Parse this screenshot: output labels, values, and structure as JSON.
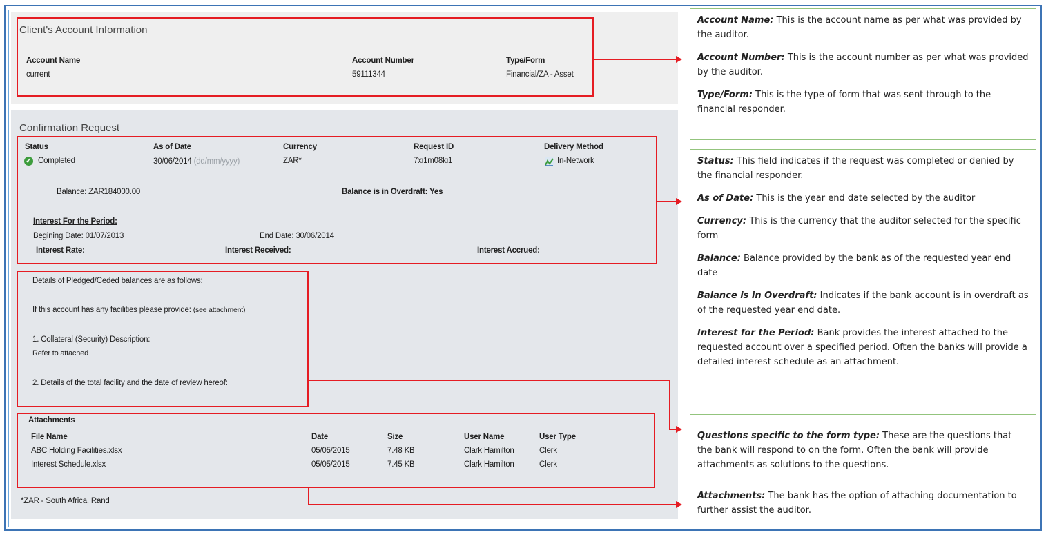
{
  "client_account": {
    "title": "Client's Account Information",
    "account_name_label": "Account Name",
    "account_name": "current",
    "account_number_label": "Account Number",
    "account_number": "59111344",
    "type_form_label": "Type/Form",
    "type_form": "Financial/ZA - Asset"
  },
  "confirmation": {
    "title": "Confirmation Request",
    "status_label": "Status",
    "status": "Completed",
    "as_of_date_label": "As of Date",
    "as_of_date": "30/06/2014",
    "date_format_hint": "(dd/mm/yyyy)",
    "currency_label": "Currency",
    "currency": "ZAR*",
    "request_id_label": "Request ID",
    "request_id": "7xi1m08ki1",
    "delivery_method_label": "Delivery Method",
    "delivery_method": "In-Network",
    "balance": "Balance: ZAR184000.00",
    "overdraft": "Balance is in Overdraft: Yes",
    "interest_title": "Interest For the Period:",
    "begin_date": "Begining Date: 01/07/2013",
    "end_date": "End Date: 30/06/2014",
    "interest_rate_label": "Interest Rate:",
    "interest_received_label": "Interest Received:",
    "interest_accrued_label": "Interest Accrued:"
  },
  "questions": {
    "q_pledged": "Details of Pledged/Ceded balances are as follows:",
    "q_facilities": "If this account has any facilities please provide:",
    "q_facilities_note": "(see attachment)",
    "q_collateral": "1. Collateral (Security) Description:",
    "a_collateral": "Refer to attached",
    "q_total_facility": "2. Details of the total facility and the date of review hereof:"
  },
  "attachments": {
    "title": "Attachments",
    "columns": [
      "File Name",
      "Date",
      "Size",
      "User Name",
      "User Type"
    ],
    "rows": [
      [
        "ABC Holding Facilities.xlsx",
        "05/05/2015",
        "7.48 KB",
        "Clark Hamilton",
        "Clerk"
      ],
      [
        "Interest Schedule.xlsx",
        "05/05/2015",
        "7.45 KB",
        "Clark Hamilton",
        "Clerk"
      ]
    ]
  },
  "footnote": "*ZAR - South Africa, Rand",
  "annotations": {
    "box1": [
      {
        "term": "Account Name:",
        "text": "This is the account name as per what was provided by the auditor."
      },
      {
        "term": "Account Number:",
        "text": "This is the account number as per what was provided by the auditor."
      },
      {
        "term": "Type/Form:",
        "text": "This is the type of form that was sent through to the financial responder."
      }
    ],
    "box2": [
      {
        "term": "Status:",
        "text": "This field indicates if the request was completed or denied by the financial responder."
      },
      {
        "term": "As of Date:",
        "text": "This is the year end date selected by the auditor"
      },
      {
        "term": "Currency:",
        "text": "This is the currency that the auditor selected for the specific form"
      },
      {
        "term": "Balance:",
        "text": "Balance provided by the bank as of the requested year end date"
      },
      {
        "term": "Balance is in Overdraft:",
        "text": "Indicates if the bank account is in overdraft as of the requested year end date."
      },
      {
        "term": "Interest for the Period:",
        "text": " Bank provides the interest attached to the requested account over a specified period. Often the banks will provide a detailed interest schedule as an attachment."
      }
    ],
    "box3": [
      {
        "term": "Questions specific to the form type:",
        "text": " These are the questions that the bank will respond to on the form. Often the bank will provide attachments as solutions to the questions."
      }
    ],
    "box4": [
      {
        "term": "Attachments:",
        "text": "The bank has the option of attaching documentation to further assist the auditor."
      }
    ]
  },
  "colors": {
    "highlight": "#e51c23",
    "frame": "#3d74b5",
    "note_border": "#93c47d",
    "status_ok": "#3c9c3c"
  }
}
